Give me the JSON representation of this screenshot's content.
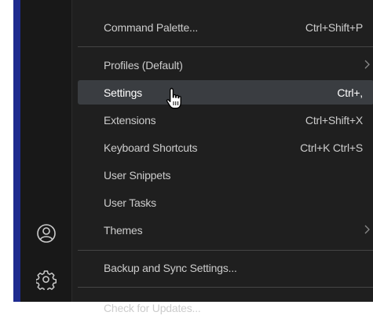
{
  "menu": {
    "items": [
      {
        "label": "Command Palette...",
        "shortcut": "Ctrl+Shift+P",
        "submenu": false
      },
      {
        "label": "Profiles (Default)",
        "shortcut": "",
        "submenu": true
      },
      {
        "label": "Settings",
        "shortcut": "Ctrl+,",
        "submenu": false,
        "selected": true
      },
      {
        "label": "Extensions",
        "shortcut": "Ctrl+Shift+X",
        "submenu": false
      },
      {
        "label": "Keyboard Shortcuts",
        "shortcut": "Ctrl+K Ctrl+S",
        "submenu": false
      },
      {
        "label": "User Snippets",
        "shortcut": "",
        "submenu": false
      },
      {
        "label": "User Tasks",
        "shortcut": "",
        "submenu": false
      },
      {
        "label": "Themes",
        "shortcut": "",
        "submenu": true
      },
      {
        "label": "Backup and Sync Settings...",
        "shortcut": "",
        "submenu": false
      },
      {
        "label": "Check for Updates...",
        "shortcut": "",
        "submenu": false
      }
    ]
  },
  "activity_bar": {
    "icons": [
      "account-icon",
      "manage-gear-icon"
    ]
  },
  "colors": {
    "menu_background": "#1f1f1f",
    "selected_background": "#3a3d41",
    "text": "#cccccc",
    "accent_border": "#1e2b8f"
  }
}
